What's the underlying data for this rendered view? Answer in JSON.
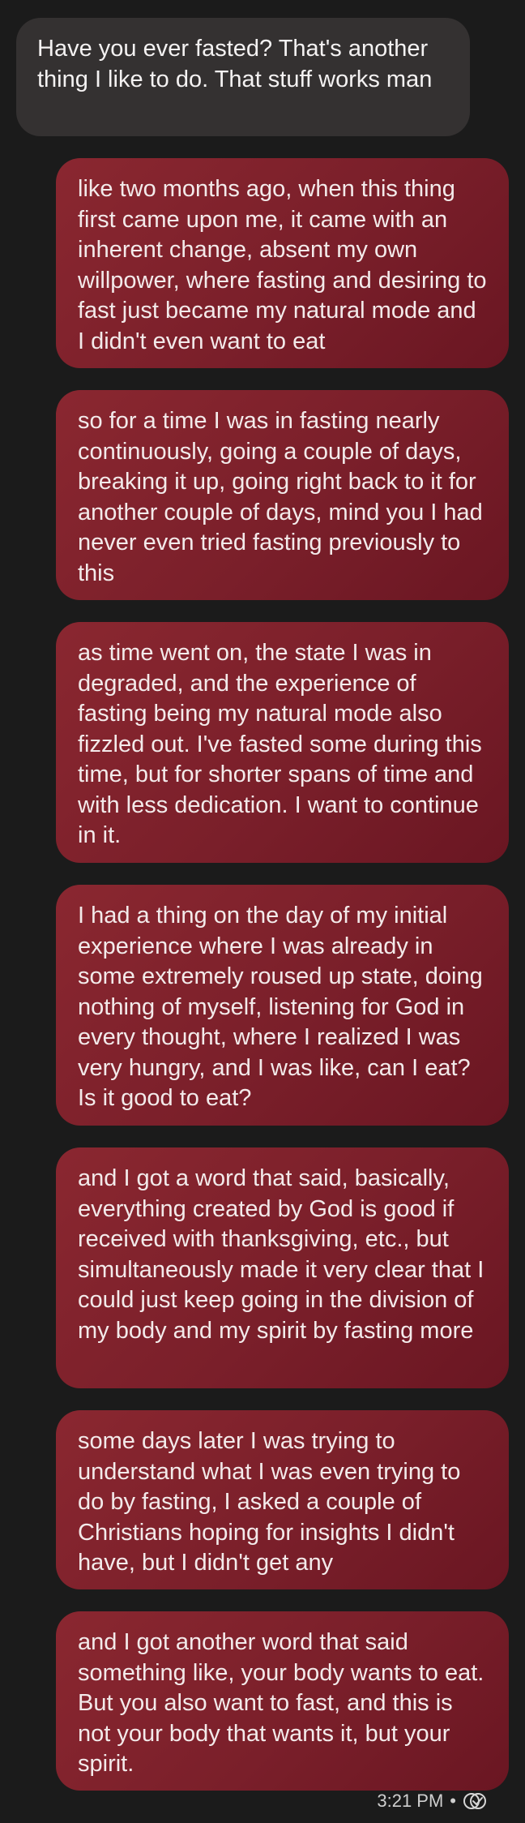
{
  "conversation": {
    "messages": [
      {
        "direction": "received",
        "text": "Have you ever fasted? That's another thing I like to do. That stuff works man"
      },
      {
        "direction": "sent",
        "text": "like two months ago, when this thing first came upon me, it came with an inherent change, absent my own willpower, where fasting and desiring to fast just became my natural mode and I didn't even want to eat"
      },
      {
        "direction": "sent",
        "text": "so for a time I was in fasting nearly continuously, going a couple of days, breaking it up, going right back to it for another couple of days, mind you I had never even tried fasting previously to this"
      },
      {
        "direction": "sent",
        "text": "as time went on, the state I was in degraded, and the experience of fasting being my natural mode also fizzled out. I've fasted some during this time, but for shorter spans of time and with less dedication. I want to continue in it."
      },
      {
        "direction": "sent",
        "text": "I had a thing on the day of my initial experience where I was already in some extremely roused up state, doing nothing of myself, listening for God in every thought, where I realized I was very hungry, and I was like, can I eat? Is it good to eat?"
      },
      {
        "direction": "sent",
        "text": "and I got a word that said, basically, everything created by God is good if received with thanksgiving, etc., but simultaneously made it very clear that I could just keep going in the division of my body and my spirit by fasting more"
      },
      {
        "direction": "sent",
        "text": "some days later I was trying to understand what I was even trying to do by fasting, I asked a couple of Christians hoping for insights I didn't have, but I didn't get any"
      },
      {
        "direction": "sent",
        "text": "and I got another word that said something like, your body wants to eat. But you also want to fast, and this is not your body that wants it, but your spirit."
      }
    ],
    "timestamp": "3:21 PM",
    "separator": "•",
    "status_icon": "read-receipt-icon"
  }
}
